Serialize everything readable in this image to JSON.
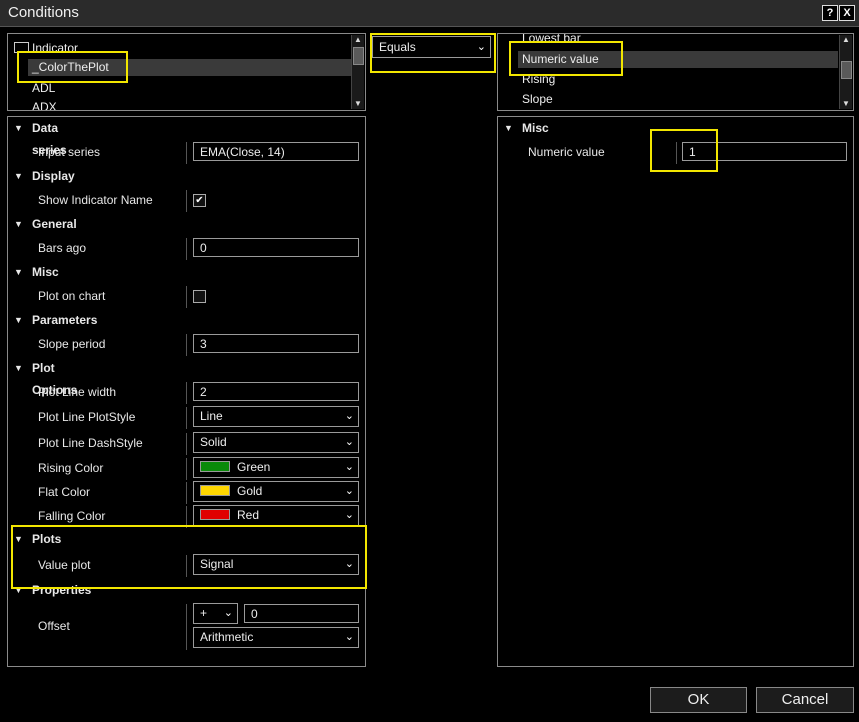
{
  "window": {
    "title": "Conditions",
    "help_label": "?",
    "close_label": "X"
  },
  "indicator_list": {
    "items": [
      "Indicator",
      "_ColorThePlot",
      "ADL",
      "ADX"
    ]
  },
  "operator": {
    "value": "Equals"
  },
  "value_list": {
    "items": [
      "Lowest bar",
      "Numeric value",
      "Rising",
      "Slope"
    ]
  },
  "left_props": {
    "categories": {
      "data_series": "Data series",
      "display": "Display",
      "general": "General",
      "misc": "Misc",
      "parameters": "Parameters",
      "plot_options": "Plot Options",
      "plots": "Plots",
      "properties": "Properties"
    },
    "input_series": {
      "label": "Input series",
      "value": "EMA(Close, 14)"
    },
    "show_indicator_name": {
      "label": "Show Indicator Name",
      "checked": true,
      "mark": "✔"
    },
    "bars_ago": {
      "label": "Bars ago",
      "value": "0"
    },
    "plot_on_chart": {
      "label": "Plot on chart",
      "checked": false
    },
    "slope_period": {
      "label": "Slope period",
      "value": "3"
    },
    "plot_line_width": {
      "label": "Plot Line width",
      "value": "2"
    },
    "plot_line_plotstyle": {
      "label": "Plot Line PlotStyle",
      "value": "Line"
    },
    "plot_line_dashstyle": {
      "label": "Plot Line DashStyle",
      "value": "Solid"
    },
    "rising_color": {
      "label": "Rising Color",
      "value": "Green",
      "color": "#0a8a0a"
    },
    "flat_color": {
      "label": "Flat Color",
      "value": "Gold",
      "color": "#ffd700"
    },
    "falling_color": {
      "label": "Falling Color",
      "value": "Red",
      "color": "#e00000"
    },
    "value_plot": {
      "label": "Value plot",
      "value": "Signal"
    },
    "offset": {
      "label": "Offset",
      "operator": "+",
      "value": "0",
      "mode": "Arithmetic"
    }
  },
  "right_props": {
    "categories": {
      "misc": "Misc"
    },
    "numeric_value": {
      "label": "Numeric value",
      "value": "1"
    }
  },
  "buttons": {
    "ok": "OK",
    "cancel": "Cancel"
  },
  "colors": {
    "highlight": "#f2e600",
    "selection": "#3a3a3a"
  },
  "icons": {
    "folder": "folder-icon",
    "collapse": "triangle-down-icon",
    "dropdown": "chevron-down-icon"
  }
}
